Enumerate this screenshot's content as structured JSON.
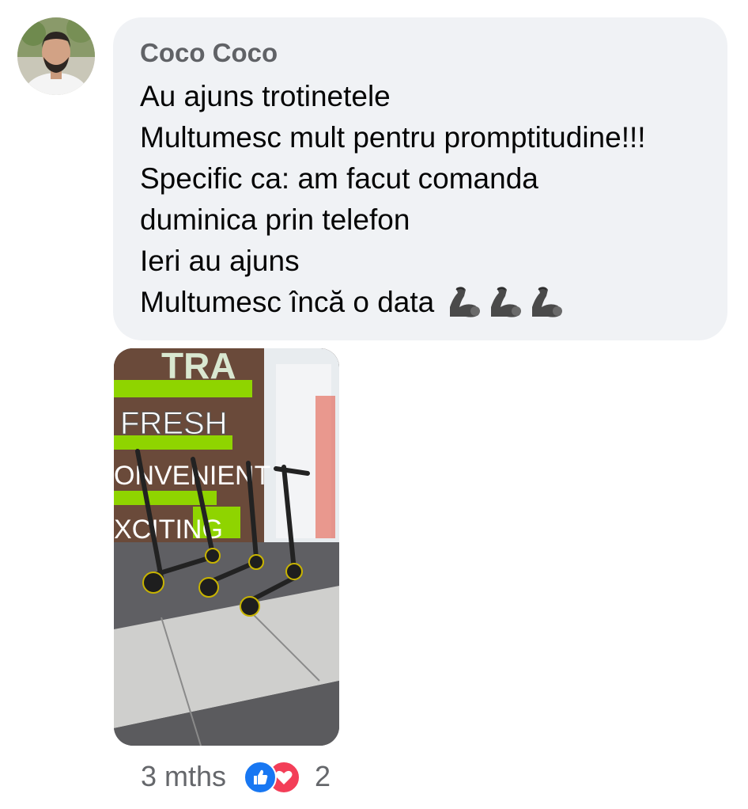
{
  "comment": {
    "author": "Coco Coco",
    "lines": [
      "Au ajuns trotinetele",
      "Multumesc mult pentru promptitudine!!!",
      "Specific ca: am facut comanda",
      "duminica prin telefon",
      "Ieri au ajuns",
      "Multumesc încă o data"
    ],
    "emoji_icons": [
      "flexed-biceps-icon",
      "flexed-biceps-icon",
      "flexed-biceps-icon"
    ],
    "attachment": {
      "sign_texts": [
        "TRA",
        "FRESH",
        "ONVENIENT",
        "XCITING"
      ]
    }
  },
  "meta": {
    "time": "3 mths",
    "reactions": [
      "like-icon",
      "love-icon"
    ],
    "reaction_count": "2"
  },
  "colors": {
    "bubble": "#f0f2f5",
    "author": "#606266",
    "text": "#050505",
    "meta": "#65676b",
    "like": "#1877f2",
    "love": "#f33e58",
    "sign_green": "#8fd400"
  }
}
